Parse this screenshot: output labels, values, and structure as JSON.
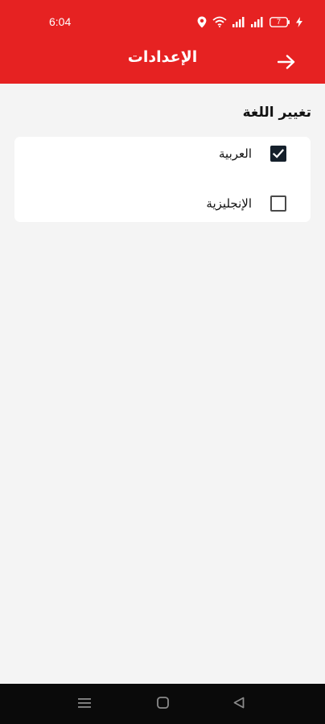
{
  "status_bar": {
    "time": "6:04",
    "icons": [
      "location-icon",
      "wifi-icon",
      "signal-icon",
      "signal-icon",
      "battery-icon",
      "charging-icon"
    ],
    "battery_level": "7"
  },
  "app_bar": {
    "title": "الإعدادات",
    "back_icon": "arrow-right-icon",
    "background": "#e62222"
  },
  "language_section": {
    "title": "تغيير اللغة",
    "options": [
      {
        "label": "العربية",
        "checked": true
      },
      {
        "label": "الإنجليزية",
        "checked": false
      }
    ]
  },
  "nav_bar": {
    "icons": [
      "menu-icon",
      "home-icon",
      "back-icon"
    ]
  }
}
